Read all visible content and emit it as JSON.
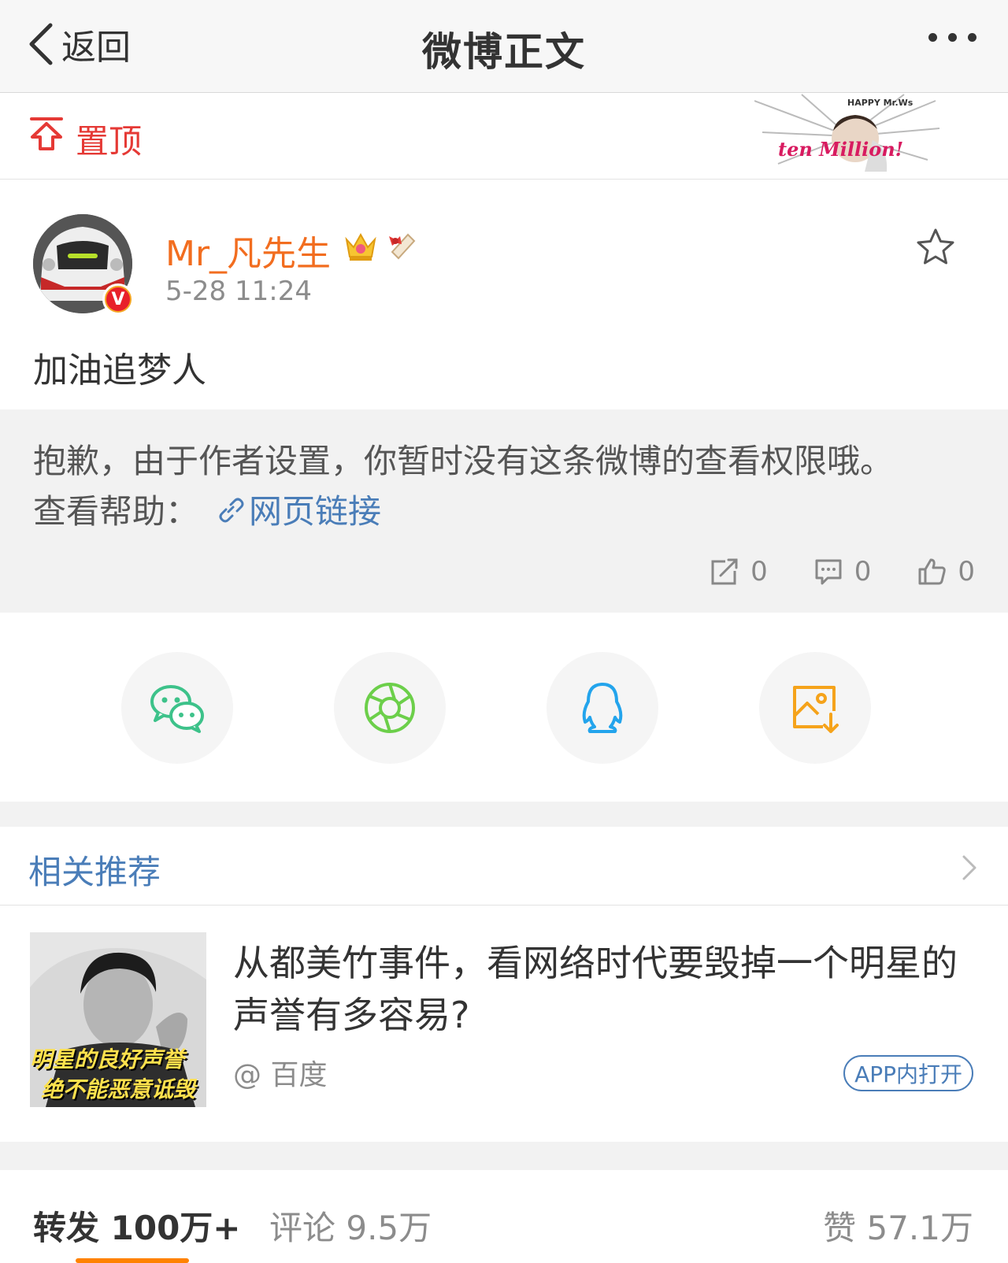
{
  "nav": {
    "back_label": "返回",
    "title": "微博正文"
  },
  "pinned": {
    "label": "置顶",
    "banner_top": "HAPPY Mr.Ws",
    "banner_main": "ten Million!"
  },
  "post": {
    "username": "Mr_凡先生",
    "timestamp": "5-28 11:24",
    "verified_mark": "V",
    "text": "加油追梦人"
  },
  "notice": {
    "message": "抱歉，由于作者设置，你暂时没有这条微博的查看权限哦。",
    "help_label": "查看帮助：",
    "link_label": "网页链接",
    "repost_count": "0",
    "comment_count": "0",
    "like_count": "0"
  },
  "share": {
    "icons": [
      "wechat-icon",
      "moments-icon",
      "qq-icon",
      "save-image-icon"
    ]
  },
  "related": {
    "title": "相关推荐",
    "headline": "从都美竹事件，看网络时代要毁掉一个明星的声誉有多容易?",
    "source": "@ 百度",
    "open_app": "APP内打开",
    "thumb_caption1": "明星的良好声誉",
    "thumb_caption2": "绝不能恶意诋毁"
  },
  "stats": {
    "repost": "转发 100万+",
    "comment": "评论 9.5万",
    "like": "赞 57.1万"
  },
  "colors": {
    "accent": "#ff8200",
    "username": "#f26d1f",
    "link": "#4a7db8",
    "pin": "#e53935"
  }
}
